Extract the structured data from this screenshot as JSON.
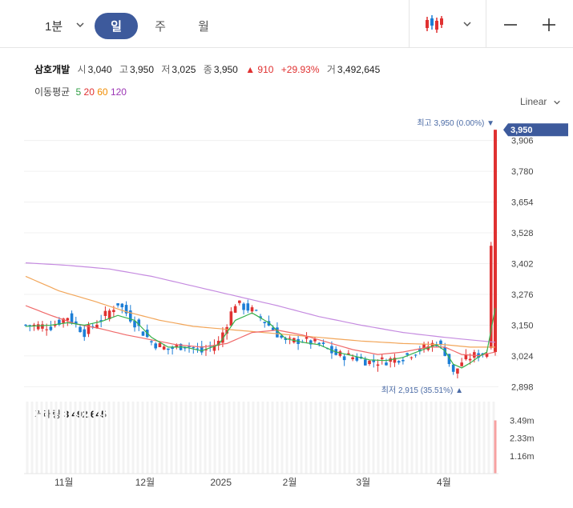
{
  "toolbar": {
    "timeframe_value": "1분",
    "periods": [
      "일",
      "주",
      "월"
    ],
    "active_period": "일",
    "chart_type_icon": "candlestick-icon",
    "zoom_out_icon": "minus-icon",
    "zoom_in_icon": "plus-icon"
  },
  "stock": {
    "name": "삼호개발",
    "open_label": "시",
    "open": "3,040",
    "high_label": "고",
    "high": "3,950",
    "low_label": "저",
    "low": "3,025",
    "close_label": "종",
    "close": "3,950",
    "change": "▲ 910",
    "change_pct": "+29.93%",
    "volume_label": "거",
    "volume": "3,492,645"
  },
  "moving_average": {
    "title": "이동평균",
    "periods": [
      {
        "label": "5",
        "color": "#2f9e44"
      },
      {
        "label": "20",
        "color": "#e03131"
      },
      {
        "label": "60",
        "color": "#f08c00"
      },
      {
        "label": "120",
        "color": "#9c36b5"
      }
    ]
  },
  "scale_mode": "Linear",
  "colors": {
    "up": "#e03131",
    "down": "#1c7ed6",
    "accent": "#3d5a9c",
    "price_tag": "#3d5a9c"
  },
  "chart_data": {
    "type": "candlestick",
    "y_ticks": [
      "3,906",
      "3,780",
      "3,654",
      "3,528",
      "3,402",
      "3,276",
      "3,150",
      "3,024",
      "2,898"
    ],
    "ylim": [
      2860,
      3990
    ],
    "x_ticks": [
      "11월",
      "12월",
      "2025",
      "2월",
      "3월",
      "4월"
    ],
    "current_price_label": "3,950",
    "high_annotation": "최고 3,950 (0.00%) ▼",
    "low_annotation": "최저 2,915 (35.51%) ▲",
    "last_candle": {
      "open": 3040,
      "high": 3950,
      "low": 3025,
      "close": 3950
    },
    "close_path": [
      [
        0,
        3150
      ],
      [
        6,
        3145
      ],
      [
        10,
        3185
      ],
      [
        14,
        3120
      ],
      [
        18,
        3175
      ],
      [
        22,
        3240
      ],
      [
        26,
        3160
      ],
      [
        30,
        3080
      ],
      [
        34,
        3050
      ],
      [
        38,
        3070
      ],
      [
        42,
        3040
      ],
      [
        46,
        3080
      ],
      [
        50,
        3240
      ],
      [
        54,
        3210
      ],
      [
        58,
        3150
      ],
      [
        62,
        3080
      ],
      [
        66,
        3090
      ],
      [
        70,
        3070
      ],
      [
        74,
        3030
      ],
      [
        78,
        3020
      ],
      [
        82,
        3000
      ],
      [
        86,
        3005
      ],
      [
        90,
        3020
      ],
      [
        94,
        3050
      ],
      [
        98,
        3080
      ],
      [
        100,
        3040
      ],
      [
        102,
        2950
      ],
      [
        104,
        3000
      ],
      [
        106,
        3020
      ],
      [
        108,
        3030
      ],
      [
        110,
        3040
      ],
      [
        112,
        3950
      ]
    ],
    "ma5": [
      [
        0,
        3145
      ],
      [
        6,
        3150
      ],
      [
        10,
        3160
      ],
      [
        14,
        3150
      ],
      [
        18,
        3165
      ],
      [
        22,
        3190
      ],
      [
        26,
        3170
      ],
      [
        30,
        3100
      ],
      [
        34,
        3060
      ],
      [
        38,
        3060
      ],
      [
        42,
        3045
      ],
      [
        46,
        3070
      ],
      [
        50,
        3170
      ],
      [
        54,
        3200
      ],
      [
        58,
        3160
      ],
      [
        62,
        3095
      ],
      [
        66,
        3080
      ],
      [
        70,
        3070
      ],
      [
        74,
        3040
      ],
      [
        78,
        3025
      ],
      [
        82,
        3008
      ],
      [
        86,
        3005
      ],
      [
        90,
        3018
      ],
      [
        94,
        3045
      ],
      [
        98,
        3070
      ],
      [
        100,
        3045
      ],
      [
        102,
        2990
      ],
      [
        104,
        2975
      ],
      [
        106,
        2995
      ],
      [
        108,
        3020
      ],
      [
        110,
        3040
      ],
      [
        112,
        3220
      ]
    ],
    "ma20": [
      [
        0,
        3230
      ],
      [
        6,
        3190
      ],
      [
        12,
        3155
      ],
      [
        18,
        3135
      ],
      [
        24,
        3110
      ],
      [
        30,
        3090
      ],
      [
        36,
        3070
      ],
      [
        42,
        3060
      ],
      [
        48,
        3075
      ],
      [
        54,
        3120
      ],
      [
        60,
        3130
      ],
      [
        66,
        3110
      ],
      [
        72,
        3080
      ],
      [
        78,
        3050
      ],
      [
        84,
        3030
      ],
      [
        90,
        3040
      ],
      [
        96,
        3060
      ],
      [
        100,
        3060
      ],
      [
        104,
        3030
      ],
      [
        108,
        3025
      ],
      [
        112,
        3040
      ]
    ],
    "ma60": [
      [
        0,
        3350
      ],
      [
        8,
        3290
      ],
      [
        16,
        3250
      ],
      [
        24,
        3205
      ],
      [
        32,
        3170
      ],
      [
        40,
        3145
      ],
      [
        50,
        3130
      ],
      [
        60,
        3115
      ],
      [
        70,
        3100
      ],
      [
        80,
        3085
      ],
      [
        90,
        3075
      ],
      [
        100,
        3070
      ],
      [
        106,
        3060
      ],
      [
        112,
        3060
      ]
    ],
    "ma120": [
      [
        0,
        3405
      ],
      [
        10,
        3395
      ],
      [
        20,
        3380
      ],
      [
        30,
        3350
      ],
      [
        40,
        3310
      ],
      [
        50,
        3270
      ],
      [
        60,
        3230
      ],
      [
        70,
        3185
      ],
      [
        80,
        3150
      ],
      [
        90,
        3120
      ],
      [
        100,
        3100
      ],
      [
        106,
        3090
      ],
      [
        112,
        3080
      ]
    ],
    "volume": {
      "label": "거래량",
      "value": "3,492,645",
      "y_ticks": [
        "3.49m",
        "2.33m",
        "1.16m"
      ],
      "ylim": [
        0,
        4200000
      ],
      "last_value": 3492645
    }
  }
}
